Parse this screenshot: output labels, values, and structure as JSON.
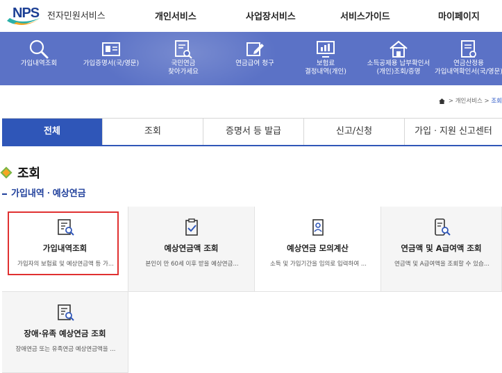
{
  "header": {
    "logo_brand": "NPS",
    "logo_text": "전자민원서비스",
    "nav": [
      "개인서비스",
      "사업장서비스",
      "서비스가이드",
      "마이페이지"
    ]
  },
  "quick_menu": [
    {
      "label": "가입내역조회",
      "icon": "search-magnifier-icon"
    },
    {
      "label": "가입증명서(국/영문)",
      "icon": "certificate-card-icon"
    },
    {
      "label": "국민연금\n찾아가세요",
      "icon": "document-search-icon"
    },
    {
      "label": "연금급여 청구",
      "icon": "pen-document-icon"
    },
    {
      "label": "보험료\n결정내역(개인)",
      "icon": "monitor-chart-icon"
    },
    {
      "label": "소득공제용 납부확인서\n(개인)조회/증명",
      "icon": "house-certificate-icon"
    },
    {
      "label": "연금산정용\n가입내역확인서(국/영문)",
      "icon": "document-person-icon"
    }
  ],
  "breadcrumb": {
    "items": [
      "개인서비스"
    ],
    "current": "조회"
  },
  "tabs": [
    {
      "label": "전체",
      "active": true
    },
    {
      "label": "조회",
      "active": false
    },
    {
      "label": "증명서 등 발급",
      "active": false
    },
    {
      "label": "신고/신청",
      "active": false
    },
    {
      "label": "가입ㆍ지원 신고센터",
      "active": false
    }
  ],
  "section": {
    "title": "조회",
    "subtitle": "가입내역ㆍ예상연금"
  },
  "cards": [
    {
      "title": "가입내역조회",
      "desc": "가입자의 보험료 및 예상연금액 등 가...",
      "icon": "document-search-icon",
      "selected": true
    },
    {
      "title": "예상연금액 조회",
      "desc": "본인이 만 60세 이후 받을 예상연금...",
      "icon": "clipboard-check-icon",
      "selected": false
    },
    {
      "title": "예상연금 모의계산",
      "desc": "소득 및 가입기간을 임의로 입력하여 ...",
      "icon": "id-card-icon",
      "selected": false
    },
    {
      "title": "연금액 및 A급여액 조회",
      "desc": "연금액 및 A급여액을 조회할 수 있습...",
      "icon": "mobile-search-icon",
      "selected": false
    },
    {
      "title": "장애·유족 예상연금 조회",
      "desc": "장애연금 또는 유족연금 예상연금액을 ...",
      "icon": "document-search-icon",
      "selected": false
    }
  ],
  "colors": {
    "quickbar": "#5b72c6",
    "tab_active": "#2f56b8",
    "brand": "#1c3f94",
    "highlight": "#e03030"
  }
}
